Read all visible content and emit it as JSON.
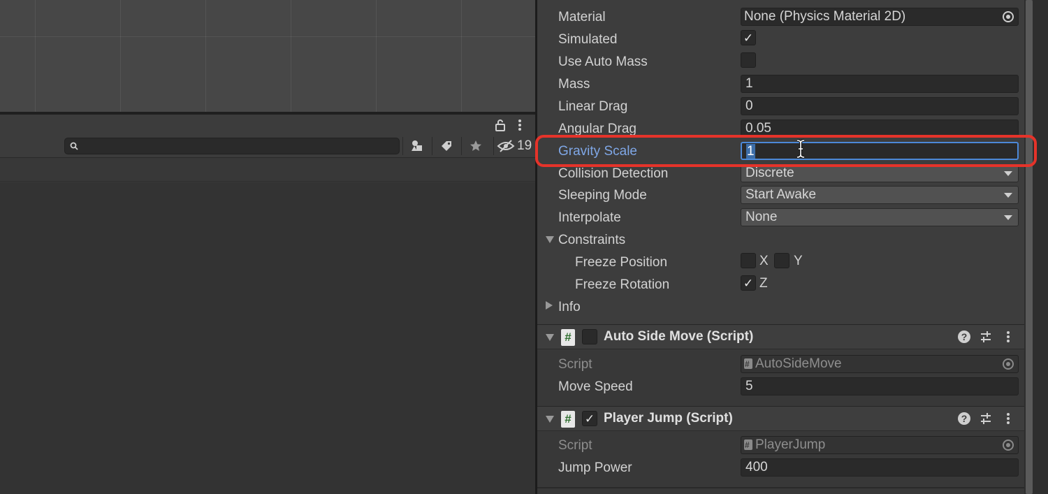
{
  "project": {
    "search_placeholder": "",
    "hidden_count": "19",
    "icons": [
      "lock-icon",
      "menu-icon",
      "search-icon",
      "filter-type-icon",
      "label-icon",
      "favorite-icon",
      "hidden-icon"
    ]
  },
  "rigidbody": {
    "material": {
      "label": "Material",
      "value": "None (Physics Material 2D)"
    },
    "simulated": {
      "label": "Simulated",
      "checked": true
    },
    "use_auto_mass": {
      "label": "Use Auto Mass",
      "checked": false
    },
    "mass": {
      "label": "Mass",
      "value": "1"
    },
    "linear_drag": {
      "label": "Linear Drag",
      "value": "0"
    },
    "angular_drag": {
      "label": "Angular Drag",
      "value": "0.05"
    },
    "gravity_scale": {
      "label": "Gravity Scale",
      "value": "1"
    },
    "collision_detection": {
      "label": "Collision Detection",
      "value": "Discrete"
    },
    "sleeping_mode": {
      "label": "Sleeping Mode",
      "value": "Start Awake"
    },
    "interpolate": {
      "label": "Interpolate",
      "value": "None"
    },
    "constraints": {
      "label": "Constraints",
      "freeze_position": {
        "label": "Freeze Position",
        "x_label": "X",
        "y_label": "Y",
        "x": false,
        "y": false
      },
      "freeze_rotation": {
        "label": "Freeze Rotation",
        "z_label": "Z",
        "z": true
      }
    },
    "info_label": "Info"
  },
  "auto_side_move": {
    "title": "Auto Side Move (Script)",
    "enabled": false,
    "script_label": "Script",
    "script_value": "AutoSideMove",
    "move_speed_label": "Move Speed",
    "move_speed_value": "5"
  },
  "player_jump": {
    "title": "Player Jump (Script)",
    "enabled": true,
    "script_label": "Script",
    "script_value": "PlayerJump",
    "jump_power_label": "Jump Power",
    "jump_power_value": "400"
  },
  "glyphs": {
    "check": "✓",
    "hash": "#",
    "help": "?"
  },
  "colors": {
    "focus_label": "#7fa7e6",
    "focus_border": "#4c89d8",
    "highlight": "#e5332a"
  }
}
